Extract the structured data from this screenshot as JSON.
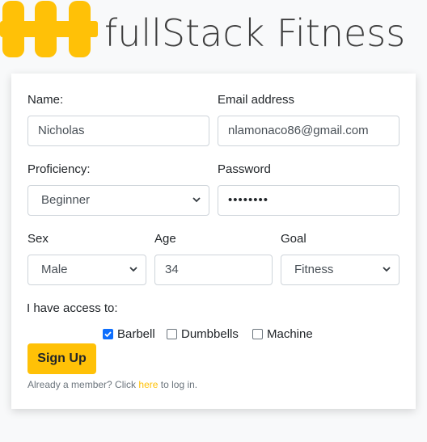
{
  "brand": {
    "title": "fullStack Fitness",
    "logo_icon": "dumbbell-icon",
    "accent": "#ffc107"
  },
  "form": {
    "name": {
      "label": "Name:",
      "value": "Nicholas"
    },
    "email": {
      "label": "Email address",
      "value": "nlamonaco86@gmail.com"
    },
    "proficiency": {
      "label": "Proficiency:",
      "value": "Beginner"
    },
    "password": {
      "label": "Password",
      "value": "••••••••"
    },
    "sex": {
      "label": "Sex",
      "value": "Male"
    },
    "age": {
      "label": "Age",
      "value": "34"
    },
    "goal": {
      "label": "Goal",
      "value": "Fitness"
    },
    "access": {
      "label": "I have access to:",
      "options": [
        {
          "label": "Barbell",
          "checked": true
        },
        {
          "label": "Dumbbells",
          "checked": false
        },
        {
          "label": "Machine",
          "checked": false
        }
      ]
    },
    "submit_label": "Sign Up",
    "footer": {
      "prefix": "Already a member? Click ",
      "link": "here",
      "suffix": " to log in."
    }
  }
}
